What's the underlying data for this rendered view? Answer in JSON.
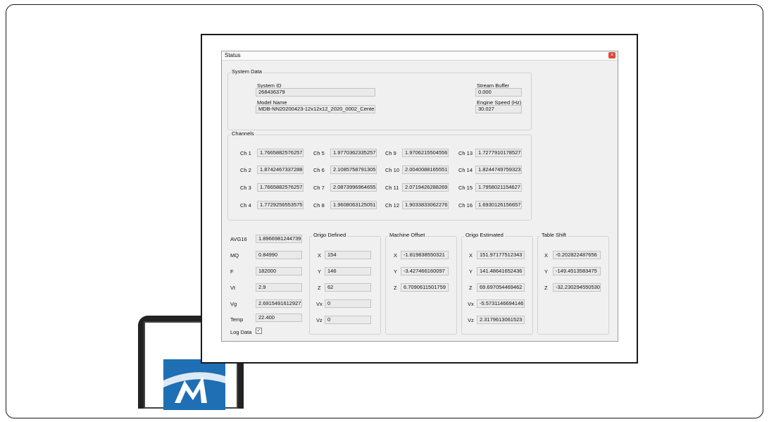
{
  "window": {
    "title": "Status",
    "close_glyph": "×"
  },
  "system_data": {
    "group_label": "System Data",
    "system_id_label": "System ID",
    "system_id": "268436379",
    "model_name_label": "Model Name",
    "model_name": "MDB-NN20200423-12x12x12_2020_0002_Cente",
    "stream_buffer_label": "Stream Buffer",
    "stream_buffer": "0.000",
    "engine_speed_label": "Engine Speed (Hz)",
    "engine_speed": "30.027"
  },
  "channels": {
    "group_label": "Channels",
    "items": [
      {
        "label": "Ch 1",
        "value": "1.7665882576257"
      },
      {
        "label": "Ch 2",
        "value": "1.8742467337288"
      },
      {
        "label": "Ch 3",
        "value": "1.7665882576257"
      },
      {
        "label": "Ch 4",
        "value": "1.7729256553575"
      },
      {
        "label": "Ch 5",
        "value": "1.9770362335257"
      },
      {
        "label": "Ch 6",
        "value": "2.1085758791305"
      },
      {
        "label": "Ch 7",
        "value": "2.0873996964655"
      },
      {
        "label": "Ch 8",
        "value": "1.9608063125051"
      },
      {
        "label": "Ch 9",
        "value": "1.9706215504556"
      },
      {
        "label": "Ch 10",
        "value": "2.0040088165551"
      },
      {
        "label": "Ch 11",
        "value": "2.0719426288269"
      },
      {
        "label": "Ch 12",
        "value": "1.9033833062276"
      },
      {
        "label": "Ch 13",
        "value": "1.7277910178527"
      },
      {
        "label": "Ch 14",
        "value": "1.8244749759323"
      },
      {
        "label": "Ch 15",
        "value": "1.7958021154627"
      },
      {
        "label": "Ch 16",
        "value": "1.6930126156657"
      }
    ]
  },
  "stats": {
    "avg16_label": "AVG16",
    "avg16": "1.8966981244739",
    "mq_label": "MQ",
    "mq": "0.84990",
    "f_label": "F",
    "f": "182000",
    "vt_label": "Vt",
    "vt": "2.9",
    "vg_label": "Vg",
    "vg": "2.6915491612927",
    "temp_label": "Temp",
    "temp": "22.400",
    "log_data_label": "Log Data",
    "log_data_checked": true,
    "check_glyph": "✓"
  },
  "origo_defined": {
    "group_label": "Origo Defined",
    "x_label": "X",
    "x": "154",
    "y_label": "Y",
    "y": "146",
    "z_label": "Z",
    "z": "62",
    "vx_label": "Vx",
    "vx": "0",
    "vz_label": "Vz",
    "vz": "0"
  },
  "machine_offset": {
    "group_label": "Machine Offset",
    "x_label": "X",
    "x": "-1.819838550321",
    "y_label": "Y",
    "y": "-3.427466160097",
    "z_label": "Z",
    "z": "6.7090611501759"
  },
  "origo_estimated": {
    "group_label": "Origo Estimated",
    "x_label": "X",
    "x": "151.97177512343",
    "y_label": "Y",
    "y": "141.48641652436",
    "z_label": "Z",
    "z": "69.697054469462",
    "vx_label": "Vx",
    "vx": "-5.5731146694146",
    "vz_label": "Vz",
    "vz": "2.3179613061523"
  },
  "table_shift": {
    "group_label": "Table Shift",
    "x_label": "X",
    "x": "-0.202822487656",
    "y_label": "Y",
    "y": "-149.4513583475",
    "z_label": "Z",
    "z": "-32.230294550530"
  },
  "colors": {
    "logo_blue": "#1e6fb3",
    "close_red": "#d84a3a",
    "window_bg": "#f0f0f0"
  }
}
